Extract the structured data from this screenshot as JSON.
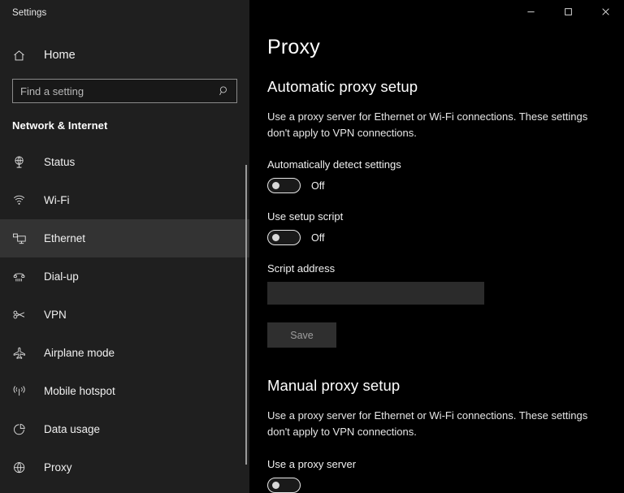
{
  "window": {
    "title": "Settings",
    "controls": [
      {
        "name": "minimize",
        "glyph": "minimize-icon"
      },
      {
        "name": "maximize",
        "glyph": "maximize-icon"
      },
      {
        "name": "close",
        "glyph": "close-icon"
      }
    ]
  },
  "sidebar": {
    "home_label": "Home",
    "home_icon": "home-icon",
    "search": {
      "placeholder": "Find a setting",
      "value": "",
      "icon": "search-icon"
    },
    "group_title": "Network & Internet",
    "items": [
      {
        "label": "Status",
        "icon": "status-globe-icon",
        "selected": false
      },
      {
        "label": "Wi-Fi",
        "icon": "wifi-icon",
        "selected": false
      },
      {
        "label": "Ethernet",
        "icon": "ethernet-monitor-icon",
        "selected": true
      },
      {
        "label": "Dial-up",
        "icon": "dialup-phone-icon",
        "selected": false
      },
      {
        "label": "VPN",
        "icon": "vpn-key-icon",
        "selected": false
      },
      {
        "label": "Airplane mode",
        "icon": "airplane-icon",
        "selected": false
      },
      {
        "label": "Mobile hotspot",
        "icon": "hotspot-icon",
        "selected": false
      },
      {
        "label": "Data usage",
        "icon": "pie-chart-icon",
        "selected": false
      },
      {
        "label": "Proxy",
        "icon": "globe-icon",
        "selected": false
      }
    ]
  },
  "main": {
    "page_title": "Proxy",
    "automatic": {
      "section_title": "Automatic proxy setup",
      "description": "Use a proxy server for Ethernet or Wi-Fi connections. These settings don't apply to VPN connections.",
      "auto_detect_label": "Automatically detect settings",
      "auto_detect_state": "Off",
      "setup_script_label": "Use setup script",
      "setup_script_state": "Off",
      "script_address_label": "Script address",
      "script_address_value": "",
      "save_label": "Save"
    },
    "manual": {
      "section_title": "Manual proxy setup",
      "description": "Use a proxy server for Ethernet or Wi-Fi connections. These settings don't apply to VPN connections.",
      "use_proxy_label": "Use a proxy server"
    }
  },
  "colors": {
    "sidebar_bg": "#1f1f1f",
    "content_bg": "#000000",
    "selected_item_bg": "#333333",
    "input_bg": "#2b2b2b",
    "button_bg": "#2f2f2f",
    "text_primary": "#ffffff",
    "text_secondary": "#e6e6e6",
    "text_disabled": "#9e9e9e",
    "scrollbar": "#9a9a9a"
  }
}
